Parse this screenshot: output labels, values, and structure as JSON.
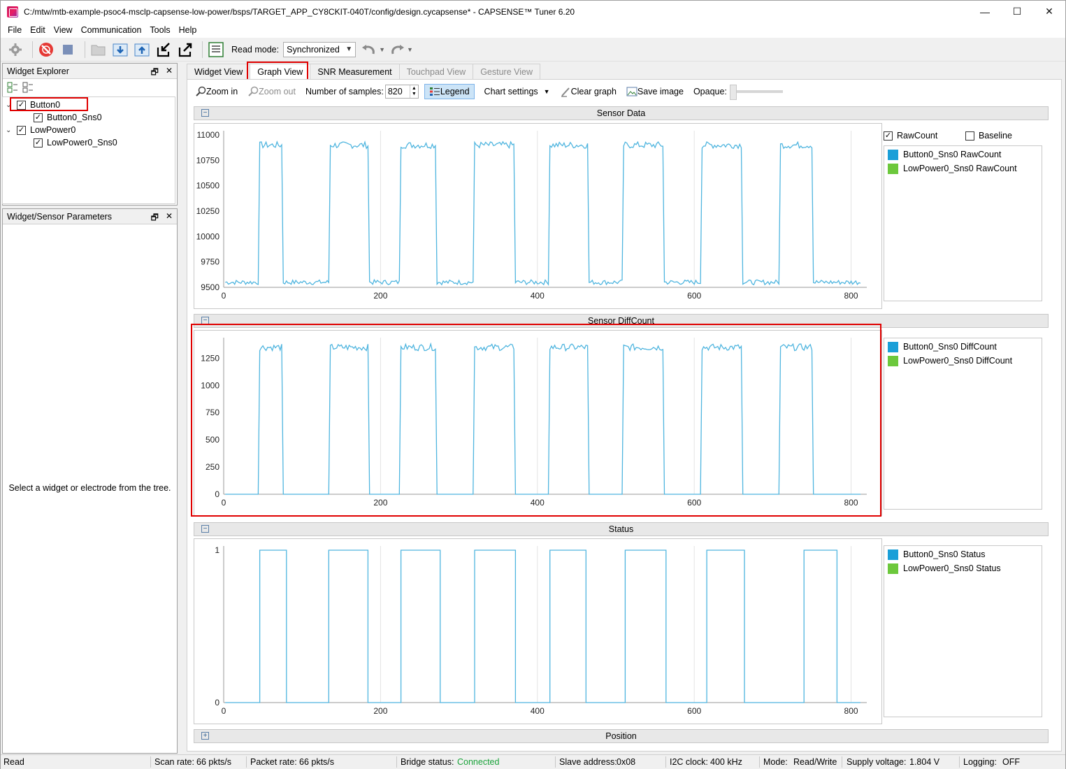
{
  "window": {
    "title": "C:/mtw/mtb-example-psoc4-msclp-capsense-low-power/bsps/TARGET_APP_CY8CKIT-040T/config/design.cycapsense* - CAPSENSE™ Tuner 6.20",
    "minimize": "—",
    "maximize": "☐",
    "close": "✕"
  },
  "menu": [
    "File",
    "Edit",
    "View",
    "Communication",
    "Tools",
    "Help"
  ],
  "toolbar": {
    "read_mode_label": "Read mode:",
    "read_mode_value": "Synchronized"
  },
  "widget_explorer": {
    "title": "Widget Explorer",
    "tree": [
      {
        "label": "Button0",
        "checked": true,
        "expanded": true
      },
      {
        "label": "Button0_Sns0",
        "checked": true
      },
      {
        "label": "LowPower0",
        "checked": true,
        "expanded": true
      },
      {
        "label": "LowPower0_Sns0",
        "checked": true
      }
    ]
  },
  "params_panel": {
    "title": "Widget/Sensor Parameters",
    "empty_text": "Select a widget or electrode from the tree."
  },
  "tabs": [
    {
      "label": "Widget View",
      "state": "normal"
    },
    {
      "label": "Graph View",
      "state": "active"
    },
    {
      "label": "SNR Measurement",
      "state": "normal"
    },
    {
      "label": "Touchpad View",
      "state": "disabled"
    },
    {
      "label": "Gesture View",
      "state": "disabled"
    }
  ],
  "graph_toolbar": {
    "zoom_in": "Zoom in",
    "zoom_out": "Zoom out",
    "samples_label": "Number of samples:",
    "samples_value": "820",
    "legend": "Legend",
    "chart_settings": "Chart settings",
    "clear_graph": "Clear graph",
    "save_image": "Save image",
    "opaque_label": "Opaque:"
  },
  "sections": {
    "sensor_data": "Sensor Data",
    "diffcount": "Sensor DiffCount",
    "status": "Status",
    "position": "Position"
  },
  "legends": {
    "rawcount_checkbox": "RawCount",
    "baseline_checkbox": "Baseline",
    "raw": [
      "Button0_Sns0 RawCount",
      "LowPower0_Sns0 RawCount"
    ],
    "diff": [
      "Button0_Sns0 DiffCount",
      "LowPower0_Sns0 DiffCount"
    ],
    "status": [
      "Button0_Sns0 Status",
      "LowPower0_Sns0 Status"
    ]
  },
  "colors": {
    "series_blue": "#1a9fd8",
    "series_green": "#6cc83c",
    "line": "#4fb5df",
    "highlight": "#e00000"
  },
  "chart_data": [
    {
      "type": "line",
      "title": "Sensor Data",
      "xlim": [
        0,
        820
      ],
      "ylim": [
        9500,
        11000
      ],
      "x_ticks": [
        0,
        200,
        400,
        600,
        800
      ],
      "y_ticks": [
        9500,
        9750,
        10000,
        10250,
        10500,
        10750,
        11000
      ],
      "low": 9550,
      "high": 10900,
      "pulses": [
        [
          45,
          75
        ],
        [
          135,
          185
        ],
        [
          225,
          270
        ],
        [
          320,
          370
        ],
        [
          415,
          465
        ],
        [
          510,
          560
        ],
        [
          610,
          660
        ],
        [
          710,
          750
        ]
      ],
      "series": [
        {
          "name": "Button0_Sns0 RawCount"
        }
      ]
    },
    {
      "type": "line",
      "title": "Sensor DiffCount",
      "xlim": [
        0,
        820
      ],
      "ylim": [
        0,
        1400
      ],
      "x_ticks": [
        0,
        200,
        400,
        600,
        800
      ],
      "y_ticks": [
        0,
        250,
        500,
        750,
        1000,
        1250
      ],
      "low": 0,
      "high": 1350,
      "pulses": [
        [
          45,
          75
        ],
        [
          135,
          185
        ],
        [
          225,
          270
        ],
        [
          320,
          370
        ],
        [
          415,
          465
        ],
        [
          510,
          560
        ],
        [
          610,
          660
        ],
        [
          710,
          750
        ]
      ],
      "series": [
        {
          "name": "Button0_Sns0 DiffCount"
        }
      ]
    },
    {
      "type": "line",
      "title": "Status",
      "xlim": [
        0,
        820
      ],
      "ylim": [
        0,
        1
      ],
      "x_ticks": [
        0,
        200,
        400,
        600,
        800
      ],
      "y_ticks": [
        0,
        1
      ],
      "low": 0,
      "high": 1,
      "pulses": [
        [
          45,
          78
        ],
        [
          133,
          183
        ],
        [
          225,
          275
        ],
        [
          320,
          370
        ],
        [
          415,
          460
        ],
        [
          512,
          562
        ],
        [
          615,
          662
        ],
        [
          740,
          780
        ]
      ],
      "series": [
        {
          "name": "Button0_Sns0 Status"
        }
      ]
    }
  ],
  "status_bar": {
    "read": "Read",
    "scan_rate_label": "Scan rate:",
    "scan_rate": "66 pkts/s",
    "packet_rate_label": "Packet rate:",
    "packet_rate": "66 pkts/s",
    "bridge_label": "Bridge status:",
    "bridge": "Connected",
    "slave_label": "Slave address:",
    "slave": "0x08",
    "i2c_label": "I2C clock:",
    "i2c": "400 kHz",
    "mode_label": "Mode:",
    "mode": "Read/Write",
    "supply_label": "Supply voltage:",
    "supply": "1.804 V",
    "logging_label": "Logging:",
    "logging": "OFF"
  }
}
